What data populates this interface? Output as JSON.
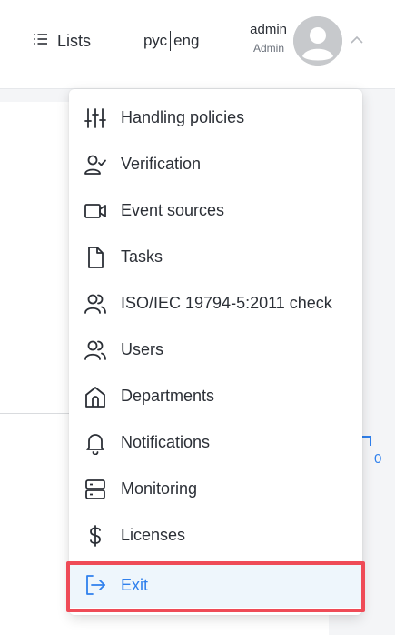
{
  "header": {
    "lists_label": "Lists",
    "lists_icon": "list-icon",
    "lang_ru": "рус",
    "lang_en": "eng",
    "user_name": "admin",
    "user_role": "Admin",
    "avatar_icon": "user-avatar-icon",
    "chevron_icon": "chevron-up-icon"
  },
  "menu": {
    "items": [
      {
        "label": "Handling policies",
        "icon": "sliders-icon"
      },
      {
        "label": "Verification",
        "icon": "user-check-icon"
      },
      {
        "label": "Event sources",
        "icon": "video-camera-icon"
      },
      {
        "label": "Tasks",
        "icon": "document-icon"
      },
      {
        "label": "ISO/IEC 19794-5:2011 check",
        "icon": "users-icon"
      },
      {
        "label": "Users",
        "icon": "users-icon"
      },
      {
        "label": "Departments",
        "icon": "home-icon"
      },
      {
        "label": "Notifications",
        "icon": "bell-icon"
      },
      {
        "label": "Monitoring",
        "icon": "server-icon"
      },
      {
        "label": "Licenses",
        "icon": "dollar-icon"
      },
      {
        "label": "Exit",
        "icon": "logout-icon"
      }
    ]
  },
  "background": {
    "badge_count": "0"
  },
  "colors": {
    "accent": "#2f80ed",
    "highlight_frame": "#ef4b57",
    "exit_bg": "#eef6fc"
  }
}
